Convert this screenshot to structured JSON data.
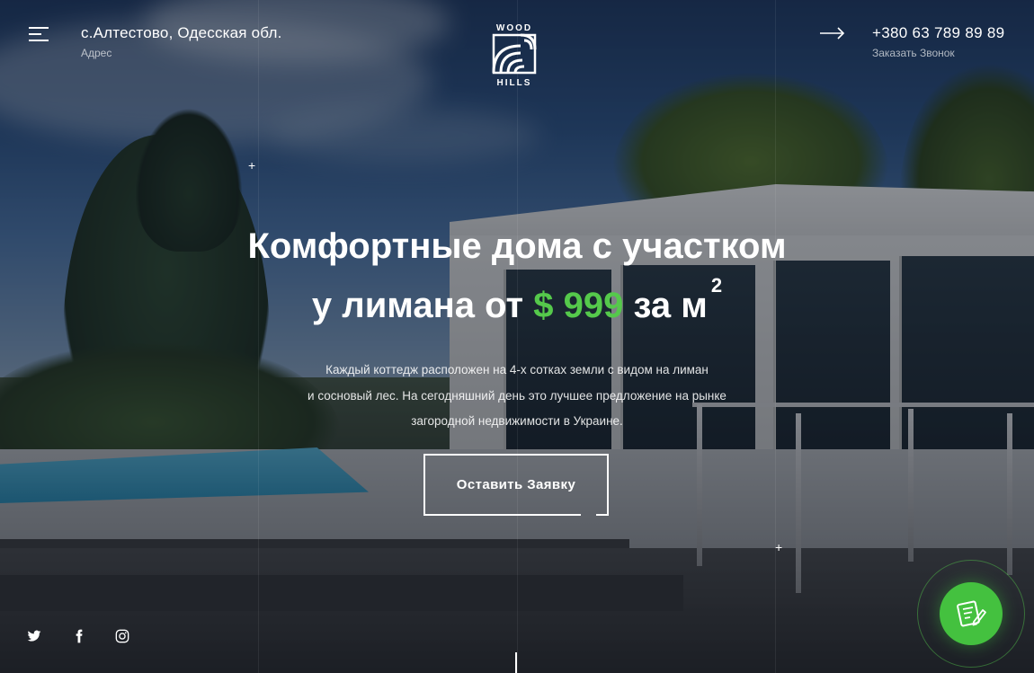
{
  "header": {
    "address_main": "с.Алтестово, Одесская обл.",
    "address_sub": "Адрес",
    "logo_top": "WOOD",
    "logo_bottom": "HILLS",
    "phone": "+380 63 789 89 89",
    "phone_sub": "Заказать Звонок"
  },
  "hero": {
    "title_line1": "Комфортные дома с участком",
    "title_line2_before": "у лимана от",
    "price": "$ 999",
    "title_line2_after": "за м",
    "title_sup": "2",
    "description": [
      "Каждый коттедж расположен на 4-х сотках земли с видом на лиман",
      "и сосновый лес. На сегодняшний день это лучшее предложение на рынке",
      "загородной недвижимости в Украине."
    ],
    "cta_label": "Оставить Заявку"
  },
  "social": [
    "twitter-icon",
    "facebook-icon",
    "instagram-icon"
  ],
  "icons": {
    "menu": "menu-icon",
    "arrow": "arrow-right-icon",
    "fab": "form-edit-icon"
  },
  "colors": {
    "accent": "#55c94b",
    "fab": "#44c13f",
    "text": "#ffffff"
  }
}
